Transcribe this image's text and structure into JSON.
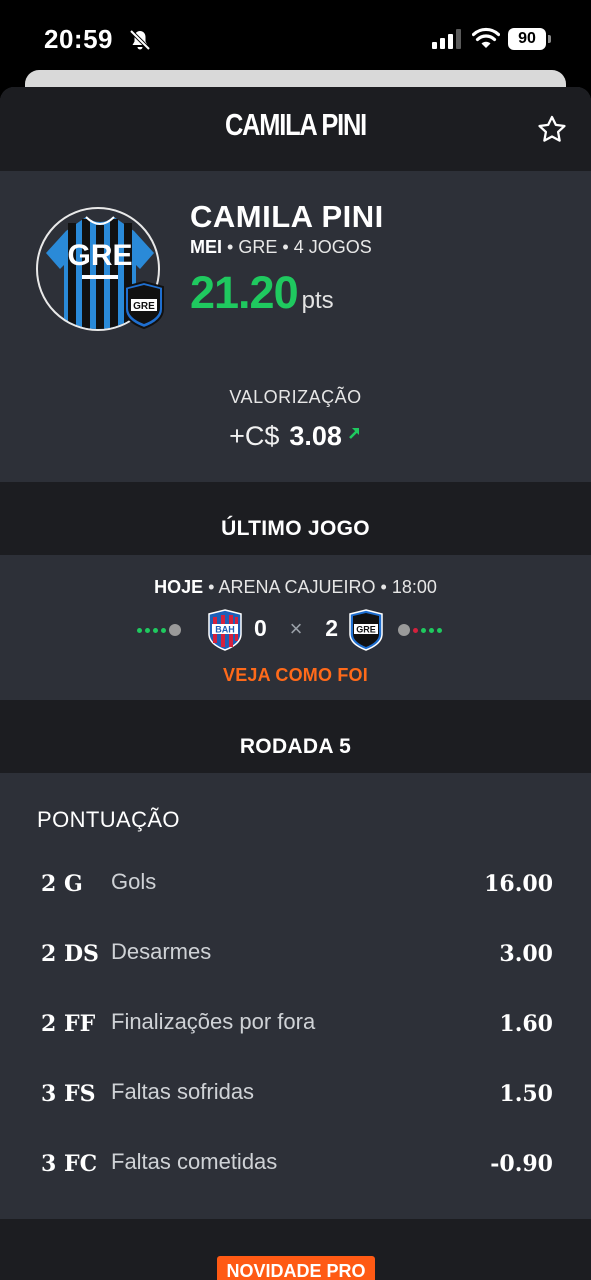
{
  "status_bar": {
    "time": "20:59",
    "battery": "90"
  },
  "header": {
    "title": "CAMILA PINI"
  },
  "player": {
    "name": "CAMILA PINI",
    "position": "MEI",
    "team": "GRE",
    "games": "4 JOGOS",
    "shirt_text": "GRE",
    "crest_text": "GRE",
    "points": "21.20",
    "points_unit": "pts",
    "valorizacao_label": "VALORIZAÇÃO",
    "valorizacao_prefix": "+C$",
    "valorizacao_value": "3.08"
  },
  "last_game": {
    "section_title": "ÚLTIMO JOGO",
    "day": "HOJE",
    "venue": "ARENA CAJUEIRO",
    "time": "18:00",
    "home_team": "BAH",
    "home_score": "0",
    "separator": "×",
    "away_score": "2",
    "away_team": "GRE",
    "link": "VEJA COMO FOI",
    "home_form": [
      "win",
      "win",
      "win",
      "win",
      "neutral"
    ],
    "away_form": [
      "neutral",
      "loss",
      "win",
      "win",
      "win"
    ]
  },
  "round": {
    "title": "RODADA 5"
  },
  "scoring": {
    "title": "PONTUAÇÃO",
    "rows": [
      {
        "code": "2 G",
        "label": "Gols",
        "points": "16.00"
      },
      {
        "code": "2 DS",
        "label": "Desarmes",
        "points": "3.00"
      },
      {
        "code": "2 FF",
        "label": "Finalizações por fora",
        "points": "1.60"
      },
      {
        "code": "3 FS",
        "label": "Faltas sofridas",
        "points": "1.50"
      },
      {
        "code": "3 FC",
        "label": "Faltas cometidas",
        "points": "-0.90"
      }
    ]
  },
  "footer": {
    "badge": "NOVIDADE PRO"
  },
  "colors": {
    "positive": "#1fc95f",
    "accent": "#ff6a1a",
    "win": "#1fc95f",
    "loss": "#d4213d",
    "neutral": "#9a9a9a",
    "home_primary": "#1d5fb8",
    "home_secondary": "#d4213d",
    "away_primary": "#1f6fd0"
  },
  "icons": {
    "bell": "bell-slash-icon",
    "signal": "cellular-signal-icon",
    "wifi": "wifi-icon",
    "battery": "battery-icon",
    "favorite": "star-outline-icon",
    "trend": "arrow-up-right-icon"
  }
}
